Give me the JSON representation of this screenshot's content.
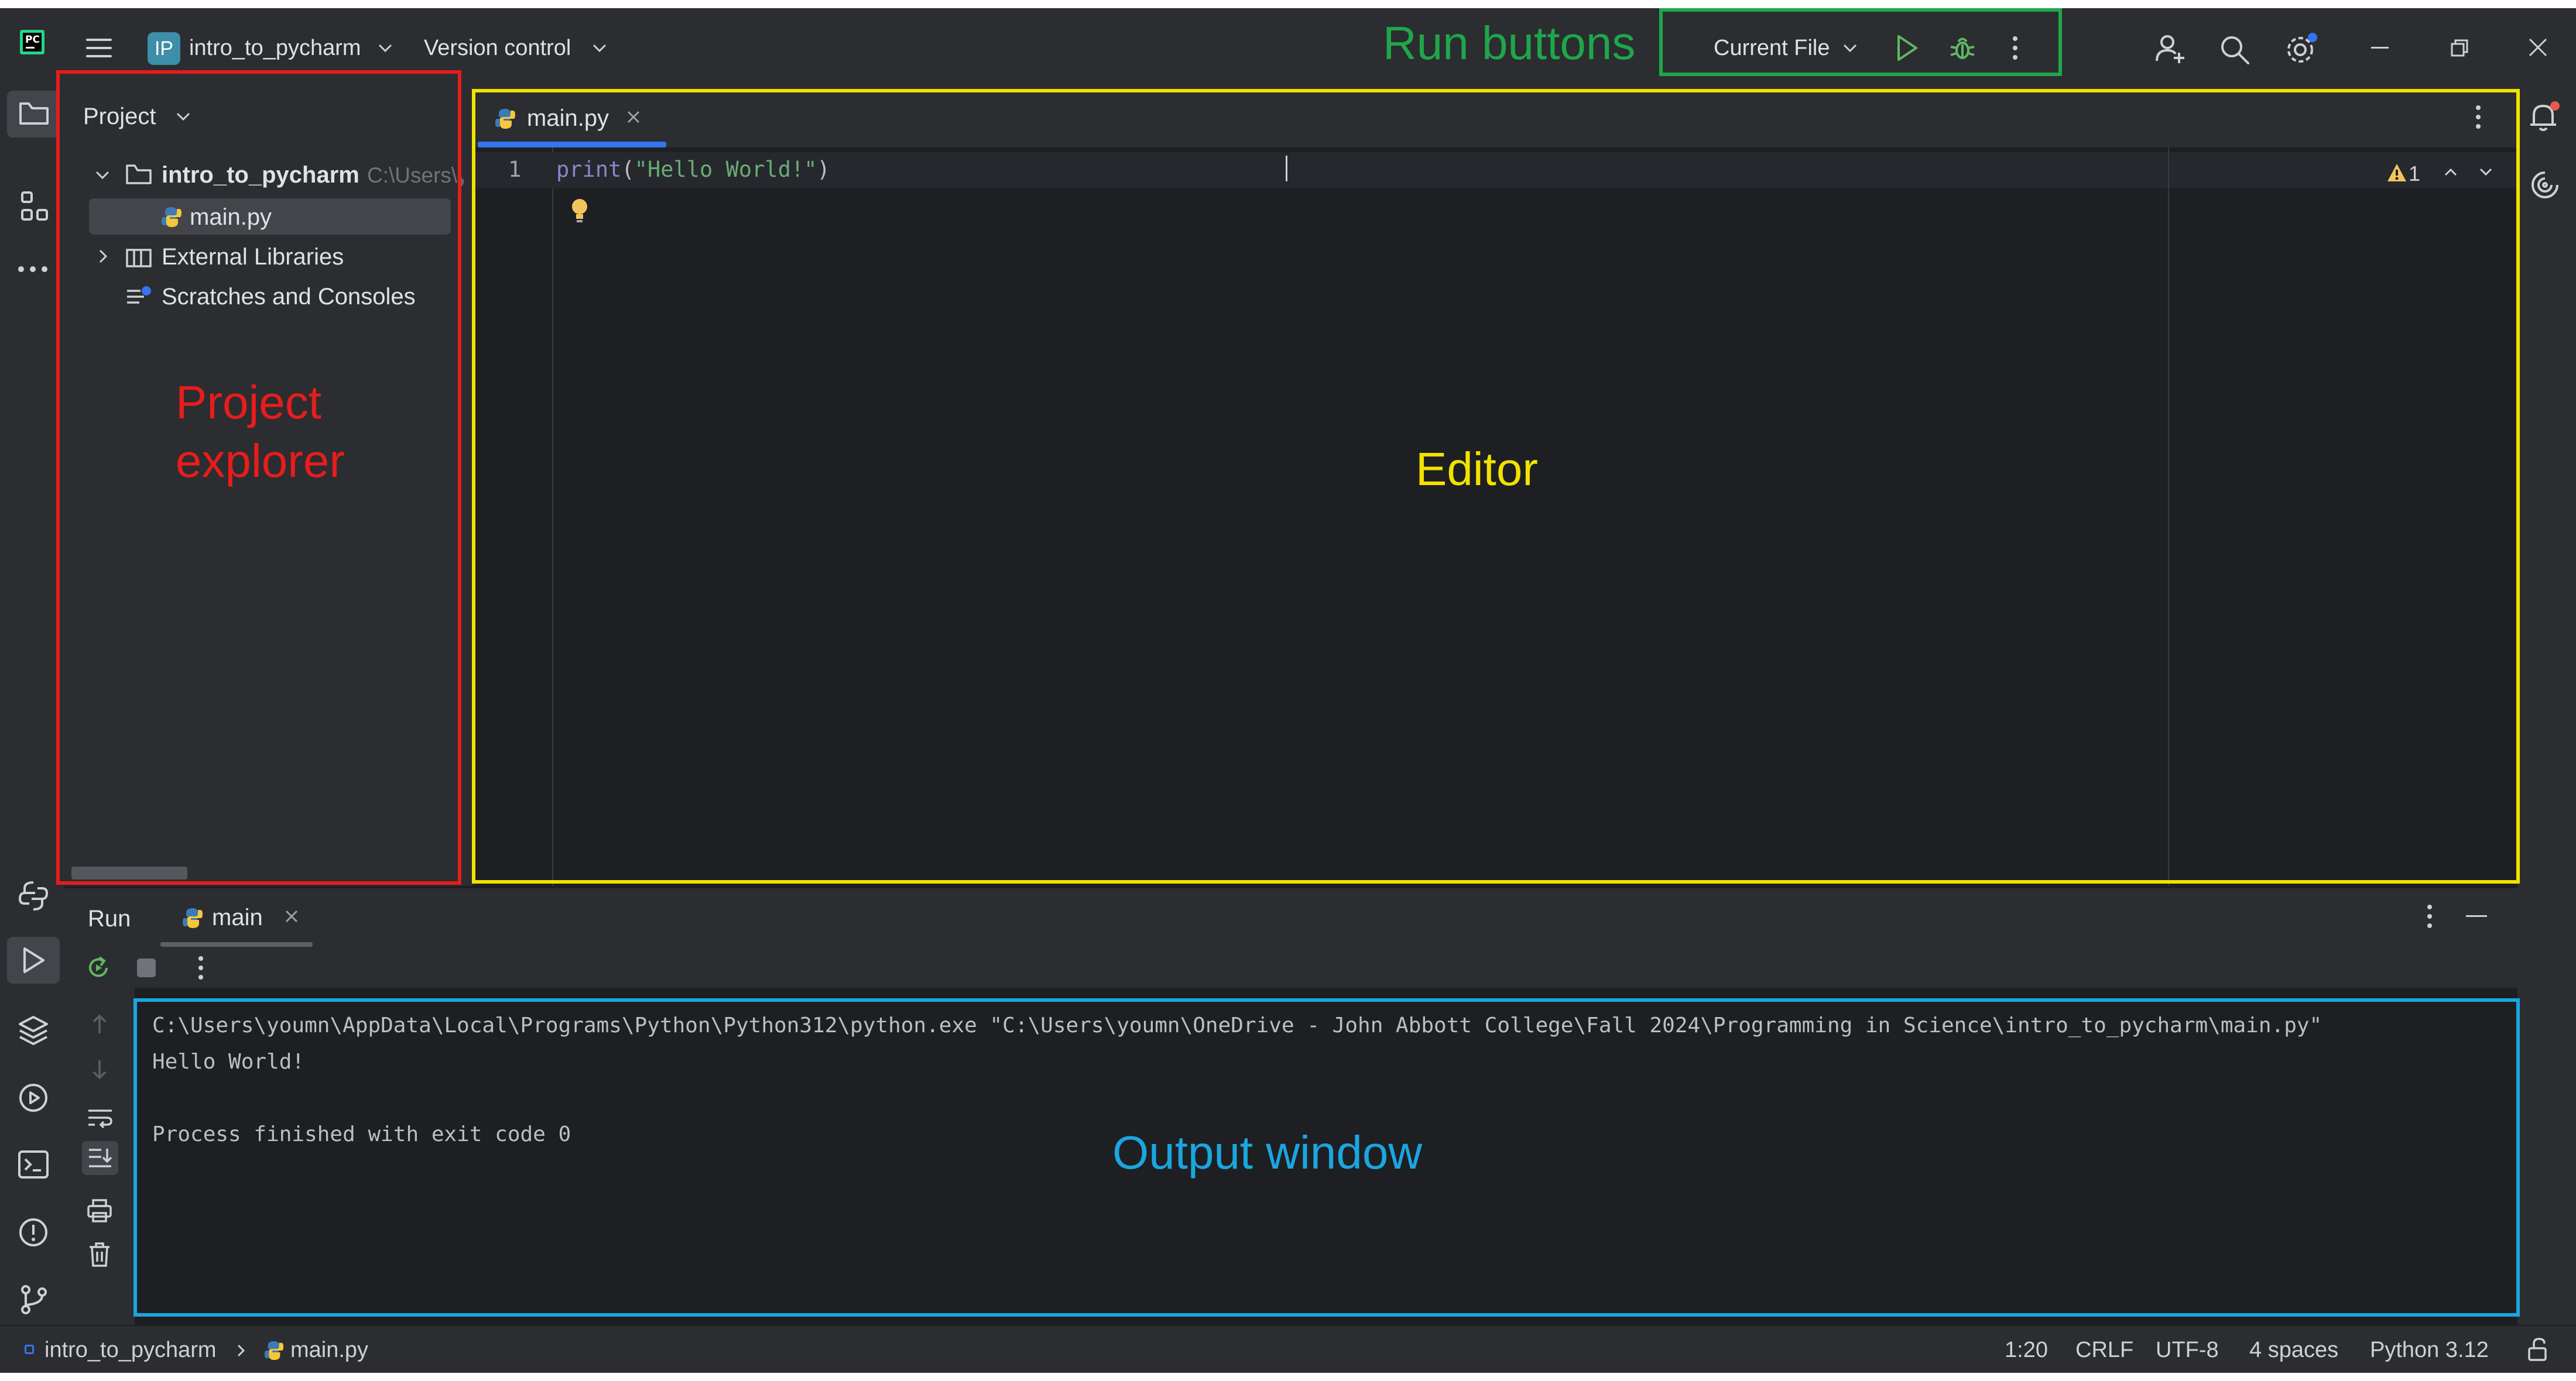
{
  "header": {
    "project_badge": "IP",
    "project_name": "intro_to_pycharm",
    "vcs_label": "Version control",
    "run_config": "Current File"
  },
  "project_panel": {
    "title": "Project",
    "tree": [
      {
        "label": "intro_to_pycharm",
        "path": "C:\\Users\\y",
        "type": "folder",
        "expanded": true
      },
      {
        "label": "main.py",
        "type": "python-file",
        "selected": true
      },
      {
        "label": "External Libraries",
        "type": "library",
        "expanded": false
      },
      {
        "label": "Scratches and Consoles",
        "type": "scratches"
      }
    ]
  },
  "editor": {
    "tab_label": "main.py",
    "line_number": "1",
    "code_func": "print",
    "code_open": "(",
    "code_string": "\"Hello World!\"",
    "code_close": ")",
    "warning_count": "1"
  },
  "run_panel": {
    "title": "Run",
    "tab_label": "main",
    "output_lines": [
      "C:\\Users\\youmn\\AppData\\Local\\Programs\\Python\\Python312\\python.exe \"C:\\Users\\youmn\\OneDrive - John Abbott College\\Fall 2024\\Programming in Science\\intro_to_pycharm\\main.py\"",
      "Hello World!",
      "",
      "Process finished with exit code 0"
    ]
  },
  "status_bar": {
    "breadcrumb_project": "intro_to_pycharm",
    "breadcrumb_file": "main.py",
    "position": "1:20",
    "line_separator": "CRLF",
    "encoding": "UTF-8",
    "indent": "4 spaces",
    "interpreter": "Python 3.12"
  },
  "annotations": {
    "run_buttons": "Run buttons",
    "project_explorer_line1": "Project",
    "project_explorer_line2": "explorer",
    "editor": "Editor",
    "output_window": "Output window"
  },
  "colors": {
    "annotation_run": "#1fa64a",
    "annotation_project": "#e81c1c",
    "annotation_editor": "#f2e200",
    "annotation_output": "#1aa6e0",
    "editor_bg": "#1e1f22",
    "panel_bg": "#2b2d30",
    "accent": "#3574f0"
  },
  "icons": [
    "pycharm-logo",
    "hamburger-menu",
    "chevron-down",
    "play",
    "debug-bug",
    "more-vertical",
    "add-user",
    "search",
    "settings",
    "minimize",
    "restore",
    "close",
    "folder",
    "plugins",
    "more-horizontal",
    "python-console",
    "run",
    "layers",
    "services",
    "terminal",
    "problems",
    "git",
    "bell",
    "ai-assistant",
    "rerun",
    "stop",
    "arrow-up",
    "arrow-down",
    "soft-wrap",
    "scroll-to-end",
    "print",
    "trash",
    "lightbulb",
    "warning",
    "lock"
  ]
}
